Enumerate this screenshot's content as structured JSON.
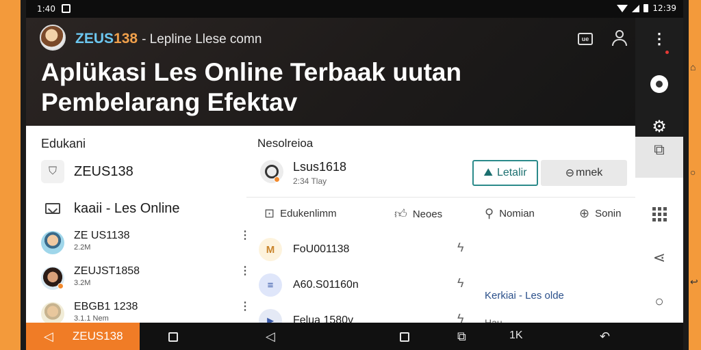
{
  "status_bar": {
    "time": "1:40",
    "clock_right": "12:39"
  },
  "header": {
    "brand_part1": "ZEUS",
    "brand_part2": "138",
    "brand_suffix": "- Lepline Llese comn",
    "headline_line1": "Aplükasi Les Online Terbaak uutan",
    "headline_line2": "Pembelarang Efektav",
    "tv_icon_text": "ue"
  },
  "left_panel": {
    "title": "Edukani",
    "row1_label": "ZEUS138",
    "row2_label": "kaaii - Les Online",
    "users": [
      {
        "name": "ZE US1138",
        "sub": "2.2M"
      },
      {
        "name": "ZEUJST1858",
        "sub": "3.2M"
      },
      {
        "name": "EBGB1 1238",
        "sub": "3.1.1 Nem"
      }
    ]
  },
  "main_panel": {
    "title": "Nesolreioa",
    "user_name": "Lsus1618",
    "user_sub": "2:34 Tlay",
    "primary_button": "Letalir",
    "secondary_button": "mnek",
    "tabs": [
      {
        "label": "Edukenlimm",
        "icon": "document-icon"
      },
      {
        "label": "Neoes",
        "icon": "thumbs-up-icon"
      },
      {
        "label": "Nomian",
        "icon": "search-icon"
      },
      {
        "label": "Sonin",
        "icon": "circle-arrow-icon"
      }
    ],
    "items": [
      {
        "label": "FoU001138",
        "icon_letter": "M"
      },
      {
        "label": "A60.S01160n",
        "icon_letter": "≡"
      },
      {
        "label": "Felua 1580v",
        "icon_letter": "▶"
      }
    ],
    "link": "Kerkiai - Les olde",
    "hint": "Hau"
  },
  "bottom_nav": {
    "active_label": "ZEUS138",
    "extra_label": "1K"
  },
  "colors": {
    "accent_orange": "#f07c26",
    "brand_blue": "#6cc7f0",
    "header_dark": "#1e1b1a",
    "button_teal": "#2a8a8a"
  }
}
